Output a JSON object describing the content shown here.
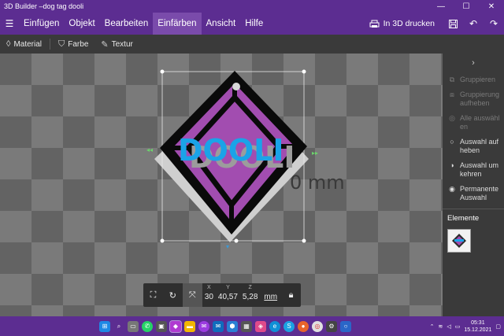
{
  "window": {
    "title": "3D Builder –dog tag dooli"
  },
  "menu": {
    "items": [
      {
        "label": "Einfügen",
        "active": false
      },
      {
        "label": "Objekt",
        "active": false
      },
      {
        "label": "Bearbeiten",
        "active": false
      },
      {
        "label": "Einfärben",
        "active": true
      },
      {
        "label": "Ansicht",
        "active": false
      },
      {
        "label": "Hilfe",
        "active": false
      }
    ],
    "print_label": "In 3D drucken"
  },
  "toolbar": {
    "material": "Material",
    "color": "Farbe",
    "texture": "Textur"
  },
  "viewport": {
    "dimension_label": "0 mm",
    "model_text": "DOOLI",
    "colors": {
      "frame": "#0a0a0a",
      "fill": "#a24db0",
      "text": "#1aa3e8",
      "base": "#cfcfcf"
    }
  },
  "transform": {
    "x_axis": "X",
    "x_value": "30",
    "y_axis": "Y",
    "y_value": "40,57",
    "z_axis": "Z",
    "z_value": "5,28",
    "unit": "mm"
  },
  "panel": {
    "items": [
      {
        "label": "Gruppieren",
        "enabled": false,
        "icon": "group-icon"
      },
      {
        "label": "Gruppierung aufheben",
        "enabled": false,
        "icon": "ungroup-icon"
      },
      {
        "label": "Alle auswählen",
        "enabled": false,
        "icon": "select-all-icon"
      },
      {
        "label": "Auswahl aufheben",
        "enabled": true,
        "icon": "deselect-icon"
      },
      {
        "label": "Auswahl umkehren",
        "enabled": true,
        "icon": "invert-selection-icon"
      },
      {
        "label": "Permanente Auswahl",
        "enabled": true,
        "icon": "permanent-selection-icon"
      }
    ],
    "elements_header": "Elemente"
  },
  "taskbar": {
    "time": "05:31",
    "date": "15.12.2021"
  }
}
